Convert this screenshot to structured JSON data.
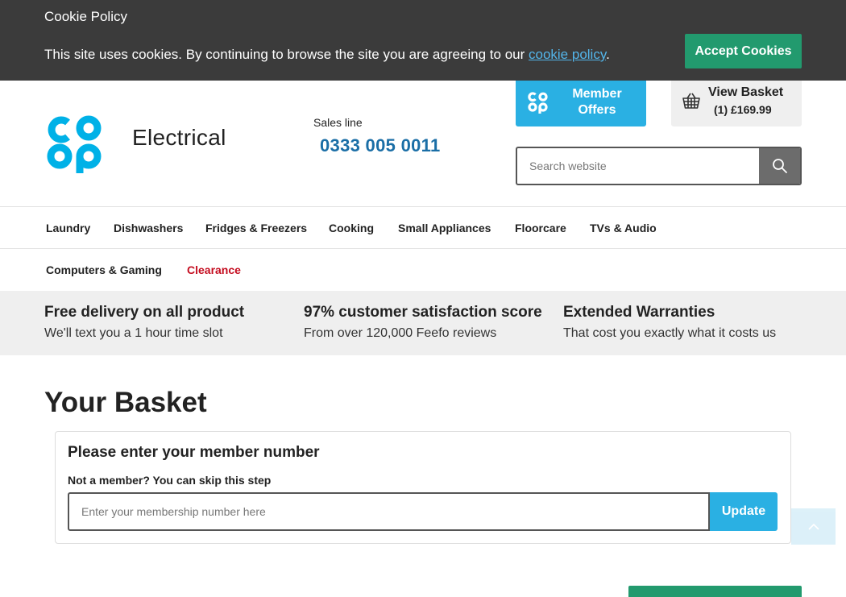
{
  "cookie": {
    "title": "Cookie Policy",
    "text_before": "This site uses cookies. By continuing to browse the site you are agreeing to our ",
    "link": "cookie policy",
    "text_after": ".",
    "accept_label": "Accept Cookies"
  },
  "header": {
    "logo_icon": "coop-logo",
    "brand_sub": "Electrical",
    "sales_label": "Sales line",
    "sales_number": "0333 005 0011",
    "member_offers": {
      "line1": "Member",
      "line2": "Offers",
      "icon": "coop-mini-logo"
    },
    "basket": {
      "title": "View Basket",
      "summary": "(1) £169.99",
      "icon": "basket-icon"
    },
    "search": {
      "placeholder": "Search website",
      "icon": "search-icon"
    }
  },
  "nav": {
    "row1": [
      "Laundry",
      "Dishwashers",
      "Fridges & Freezers",
      "Cooking",
      "Small Appliances",
      "Floorcare",
      "TVs & Audio"
    ],
    "row2": [
      "Computers & Gaming",
      "Clearance"
    ]
  },
  "usps": [
    {
      "title": "Free delivery on all product",
      "sub": "We'll text you a 1 hour time slot"
    },
    {
      "title": "97% customer satisfaction score",
      "sub": "From over 120,000 Feefo reviews"
    },
    {
      "title": "Extended Warranties",
      "sub": "That cost you exactly what it costs us"
    }
  ],
  "basket_page": {
    "title": "Your Basket",
    "member_panel": {
      "title": "Please enter your member number",
      "subtitle": "Not a member? You can skip this step",
      "placeholder": "Enter your membership number here",
      "update_label": "Update"
    }
  },
  "colors": {
    "coop_blue": "#00b1e7",
    "accent_green": "#229a6e",
    "sales_blue": "#1a6ea6",
    "clearance_red": "#c40c1f"
  }
}
